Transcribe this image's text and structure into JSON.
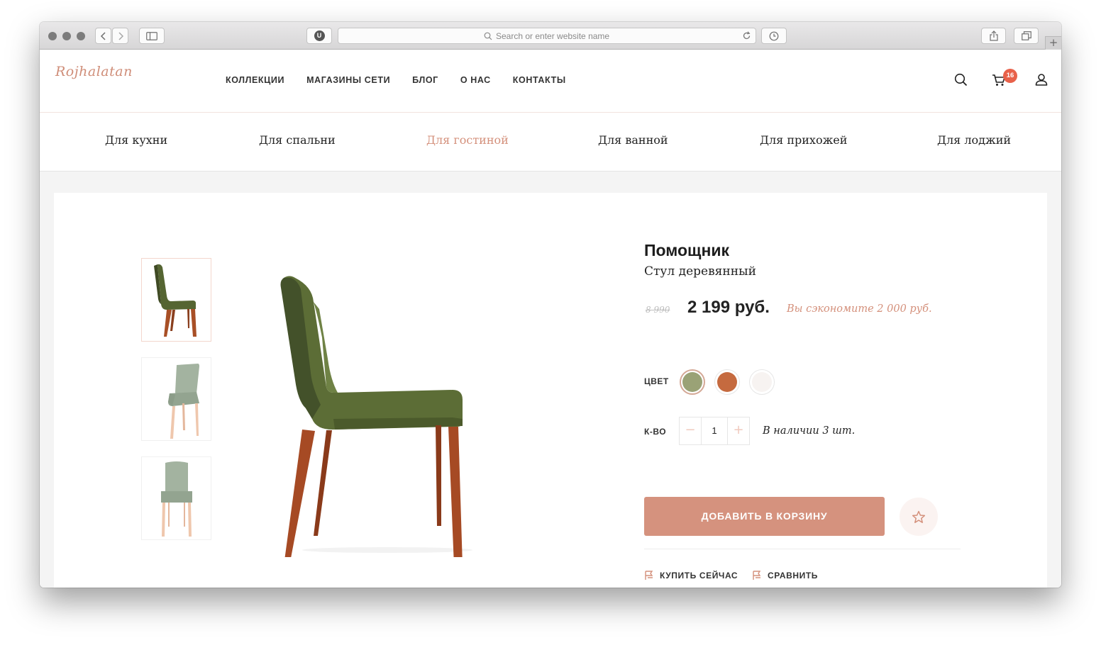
{
  "browser": {
    "address_placeholder": "Search or enter website name",
    "extension_label": "U",
    "new_tab_symbol": "+"
  },
  "site": {
    "logo_text": "Rojhalatan",
    "nav": [
      "КОЛЛЕКЦИИ",
      "МАГАЗИНЫ СЕТИ",
      "БЛОГ",
      "О НАС",
      "КОНТАКТЫ"
    ],
    "cart_count": "16",
    "icons": [
      "search-icon",
      "cart-icon",
      "user-icon"
    ]
  },
  "categories": [
    {
      "label": "Для кухни",
      "active": false
    },
    {
      "label": "Для спальни",
      "active": false
    },
    {
      "label": "Для гостиной",
      "active": true
    },
    {
      "label": "Для ванной",
      "active": false
    },
    {
      "label": "Для прихожей",
      "active": false
    },
    {
      "label": "Для лоджий",
      "active": false
    }
  ],
  "product": {
    "title": "Помощник",
    "subtitle": "Стул деревянный",
    "old_price": "8 990",
    "price": "2 199 руб.",
    "savings": "Вы сэкономите 2 000 руб.",
    "color_label": "ЦВЕТ",
    "colors": [
      {
        "name": "olive",
        "hex": "#9aa276",
        "selected": true
      },
      {
        "name": "terracotta",
        "hex": "#c56a3f",
        "selected": false
      },
      {
        "name": "ivory",
        "hex": "#f7f3f1",
        "selected": false
      }
    ],
    "qty_label": "К-ВО",
    "qty_minus": "−",
    "qty_value": "1",
    "qty_plus": "+",
    "stock": "В наличии 3 шт.",
    "add_to_cart": "ДОБАВИТЬ В КОРЗИНУ",
    "buy_now": "КУПИТЬ СЕЙЧАС",
    "compare": "СРАВНИТЬ",
    "thumbnails": [
      "chair-green-side",
      "chair-sage-angle",
      "chair-sage-front"
    ]
  },
  "colors": {
    "accent": "#d5927e",
    "badge": "#e8614a",
    "active_category": "#d4907b"
  }
}
